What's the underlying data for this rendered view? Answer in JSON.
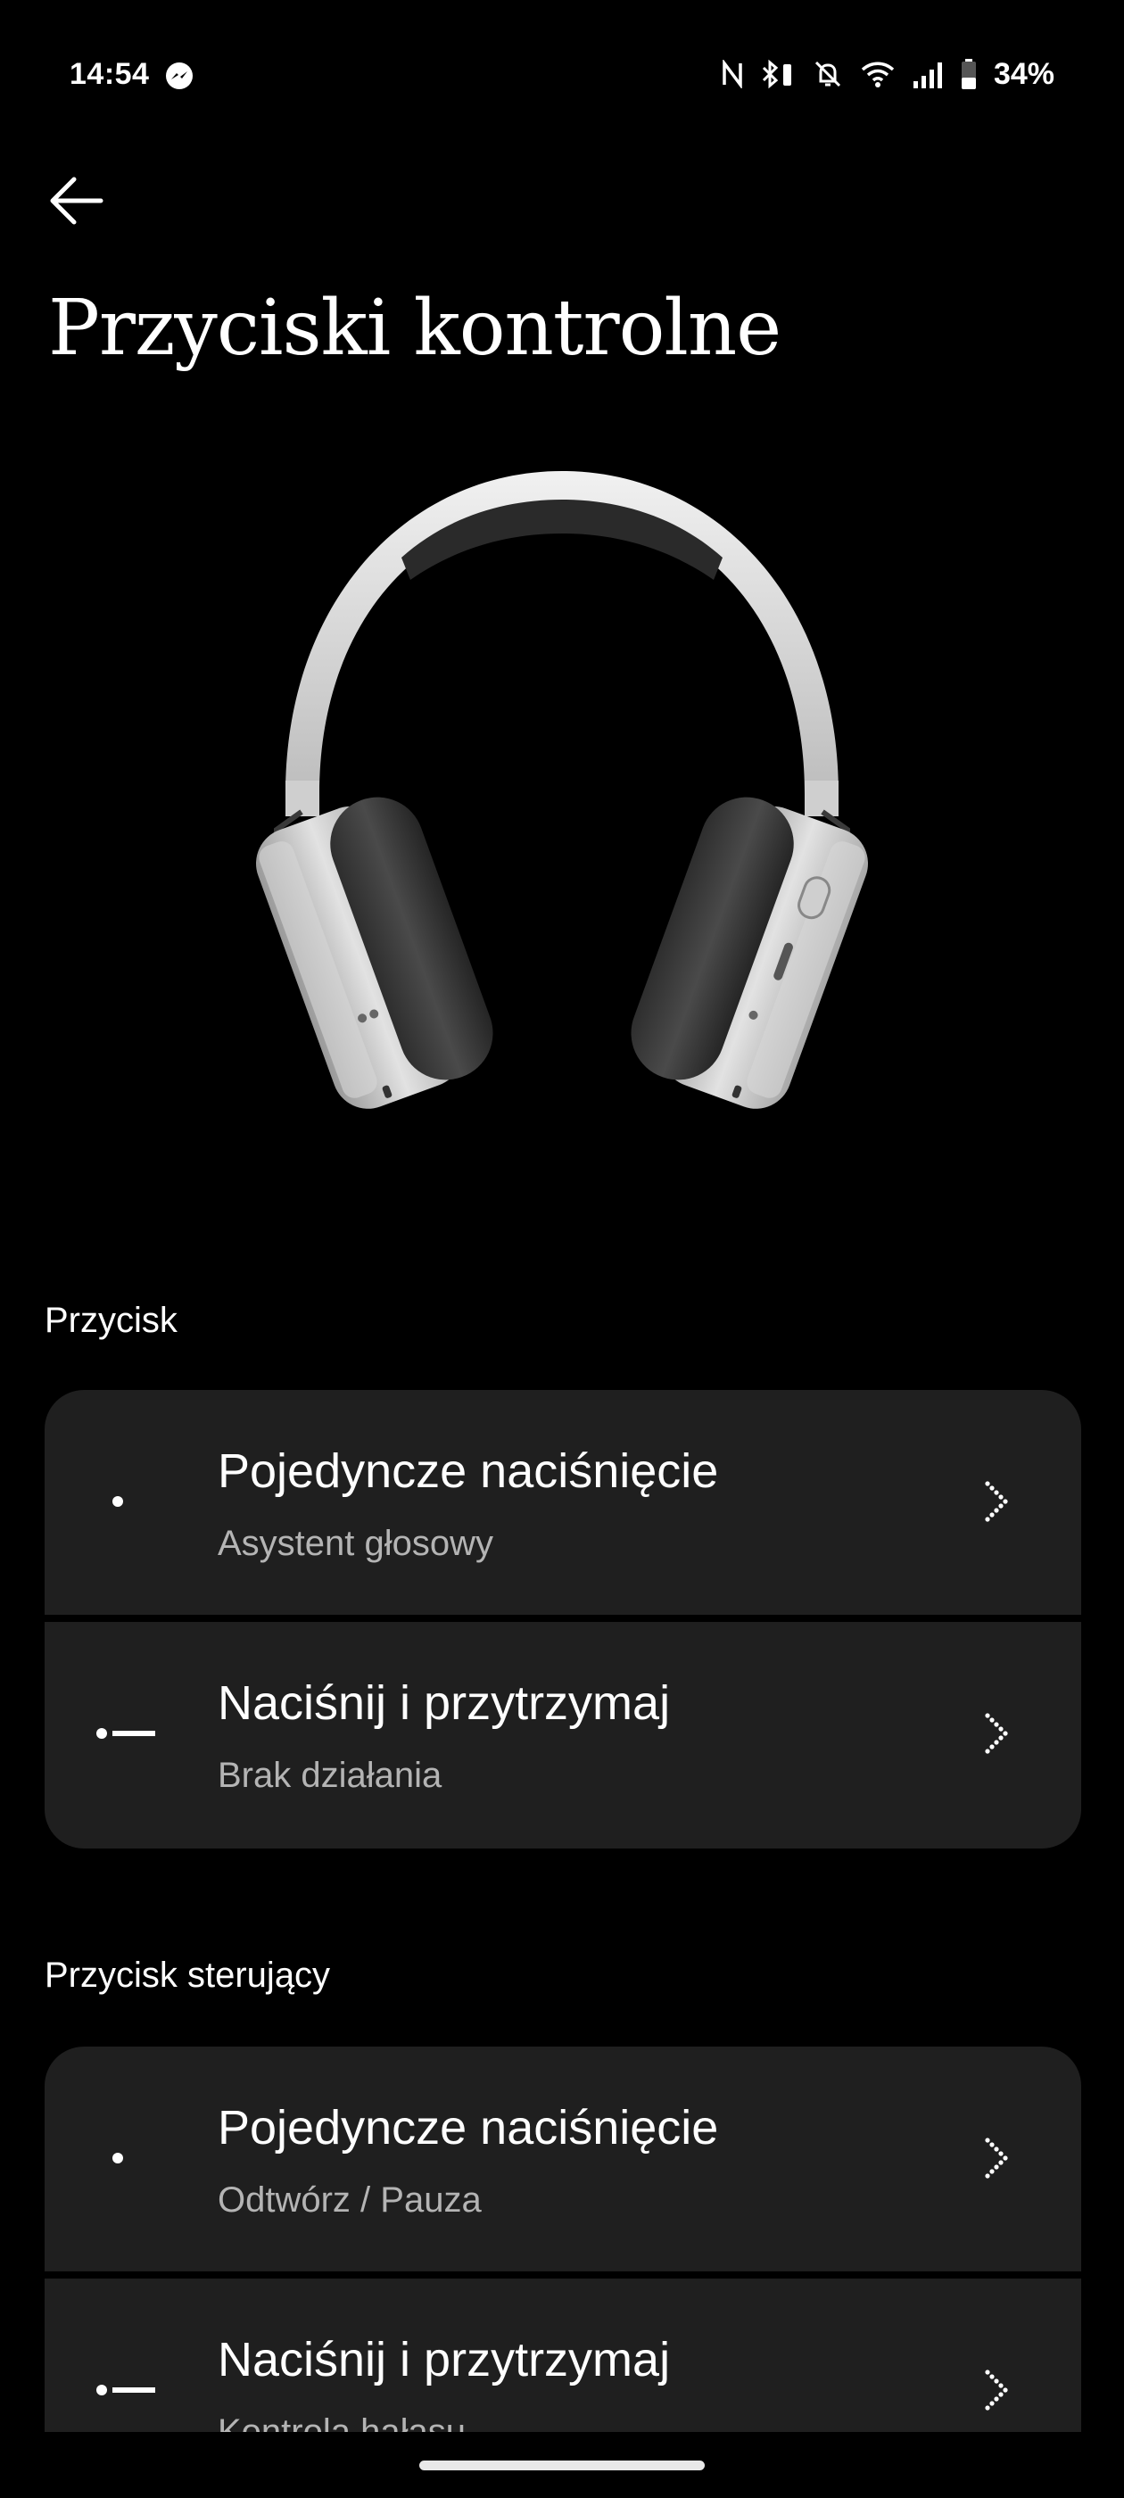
{
  "status_bar": {
    "time": "14:54",
    "battery": "34%",
    "icons": [
      "messenger-icon",
      "nfc-icon",
      "bluetooth-battery-icon",
      "bell-off-icon",
      "wifi-icon",
      "signal-icon",
      "battery-icon"
    ]
  },
  "header": {
    "back_icon": "arrow-left-icon",
    "title": "Przyciski kontrolne"
  },
  "sections": [
    {
      "heading": "Przycisk",
      "rows": [
        {
          "icon": "single-press-icon",
          "title": "Pojedyncze naciśnięcie",
          "subtitle": "Asystent głosowy"
        },
        {
          "icon": "press-hold-icon",
          "title": "Naciśnij i przytrzymaj",
          "subtitle": "Brak działania"
        }
      ]
    },
    {
      "heading": "Przycisk sterujący",
      "rows": [
        {
          "icon": "single-press-icon",
          "title": "Pojedyncze naciśnięcie",
          "subtitle": "Odtwórz / Pauza"
        },
        {
          "icon": "press-hold-icon",
          "title": "Naciśnij i przytrzymaj",
          "subtitle": "Kontrola hałasu"
        }
      ]
    }
  ],
  "colors": {
    "background": "#000000",
    "card": "#1f1f1f",
    "subtitle": "#b4b4b4"
  }
}
